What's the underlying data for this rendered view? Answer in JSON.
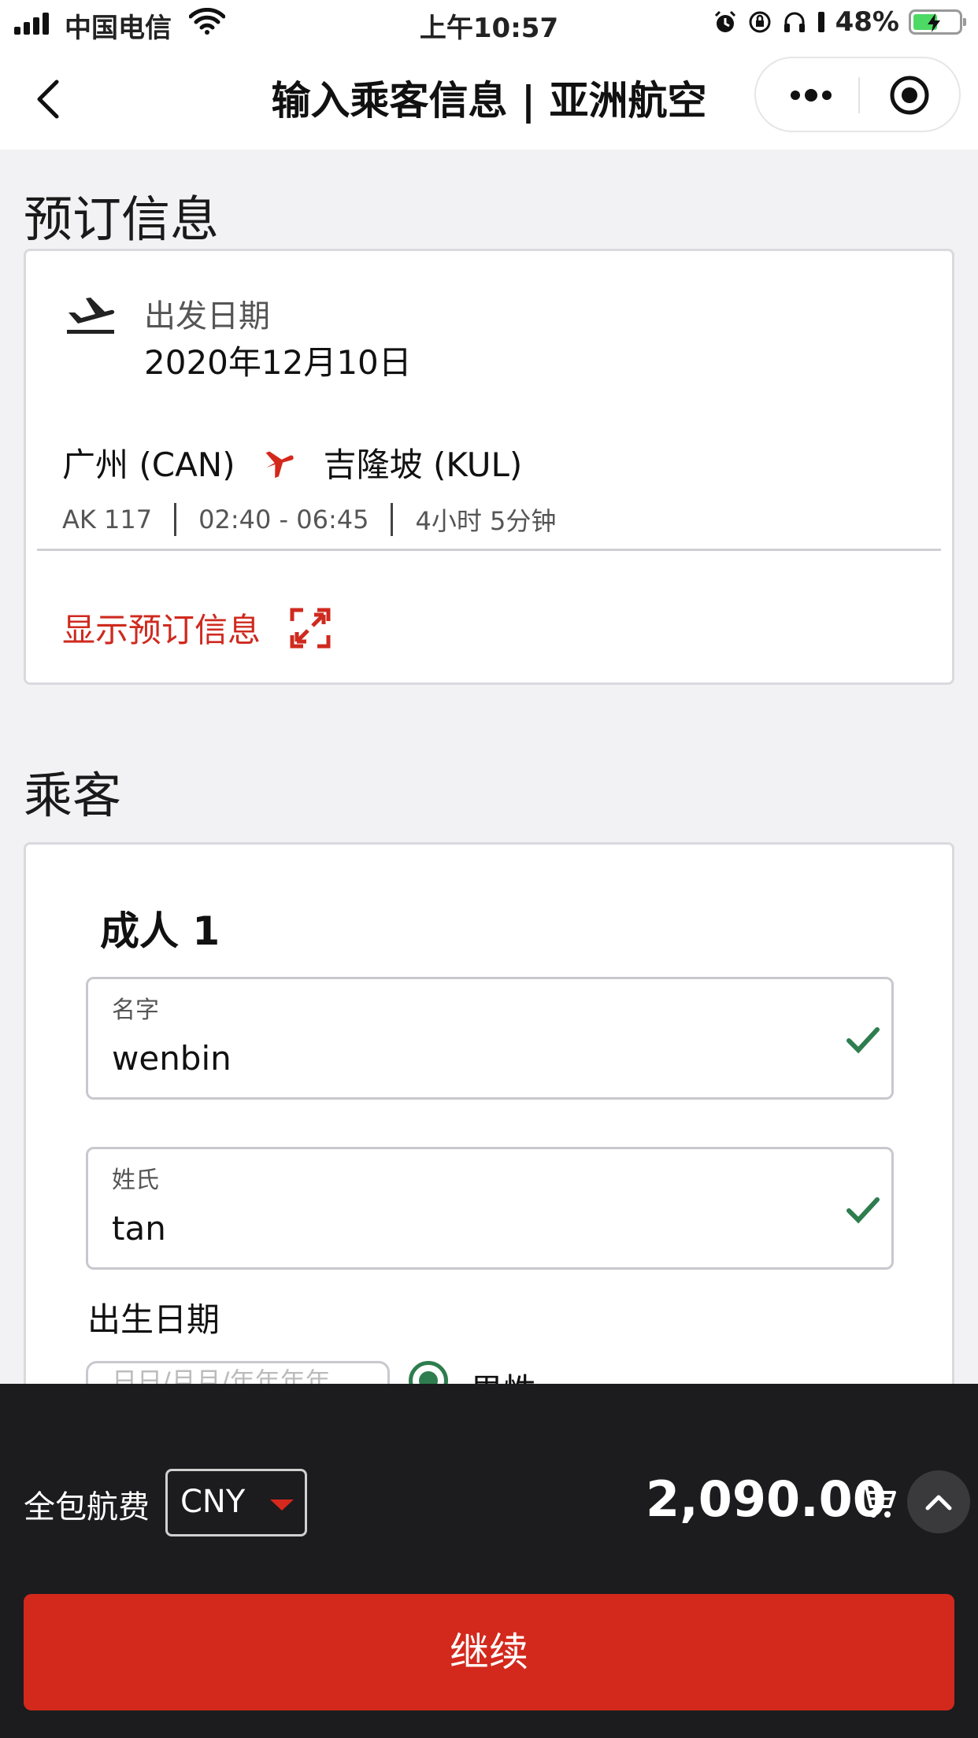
{
  "status_bar": {
    "carrier": "中国电信",
    "time": "上午10:57",
    "battery": "48%",
    "icons": [
      "signal-icon",
      "wifi-icon",
      "alarm-icon",
      "rotation-lock-icon",
      "headphones-icon",
      "battery-icon"
    ]
  },
  "nav": {
    "title": "输入乘客信息 | 亚洲航空",
    "icons": [
      "back-chevron-icon",
      "more-dots-icon",
      "target-icon"
    ]
  },
  "booking": {
    "section_title": "预订信息",
    "departure_label": "出发日期",
    "departure_date": "2020年12月10日",
    "origin": "广州 (CAN)",
    "destination": "吉隆坡 (KUL)",
    "flight_number": "AK 117",
    "time_range": "02:40 - 06:45",
    "duration": "4小时 5分钟",
    "show_details_label": "显示预订信息",
    "accent_color": "#cf2a1f"
  },
  "passengers": {
    "section_title": "乘客",
    "passenger_heading": "成人 1",
    "first_name": {
      "label": "名字",
      "value": "wenbin"
    },
    "last_name": {
      "label": "姓氏",
      "value": "tan"
    },
    "dob_label": "出生日期",
    "dob_placeholder": "日日/月月/年年年年",
    "gender_option": "男性",
    "valid_color": "#2e7d4f"
  },
  "footer": {
    "fare_label": "全包航费",
    "currency": "CNY",
    "total": "2,090.00",
    "continue_label": "继续",
    "button_color": "#d3291c"
  }
}
